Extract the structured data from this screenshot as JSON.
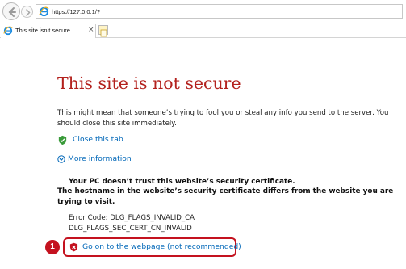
{
  "browser": {
    "url": "https://127.0.0.1/?",
    "tab_title": "This site isn’t secure",
    "tab_close": "×"
  },
  "page": {
    "title": "This site is not secure",
    "description": "This might mean that someone’s trying to fool you or steal any info you send to the server. You should close this site immediately.",
    "close_tab_label": "Close this tab",
    "more_info_label": "More information",
    "trust_message": "Your PC doesn’t trust this website’s security certificate.",
    "hostname_message": "The hostname in the website’s security certificate differs from the website you are trying to visit.",
    "error_code_line1": "Error Code: DLG_FLAGS_INVALID_CA",
    "error_code_line2": "DLG_FLAGS_SEC_CERT_CN_INVALID",
    "go_on_label": "Go on to the webpage (not recommended)"
  },
  "annotation": {
    "badge_number": "1",
    "color": "#c4121f"
  },
  "colors": {
    "title_red": "#b3211d",
    "link_blue": "#0067b8"
  },
  "icons": {
    "back": "back-arrow-icon",
    "forward": "forward-arrow-icon",
    "ie": "ie-logo-icon",
    "close_tab_shield": "green-shield-check-icon",
    "more_info": "chevron-down-circle-icon",
    "go_on": "red-shield-x-icon"
  }
}
